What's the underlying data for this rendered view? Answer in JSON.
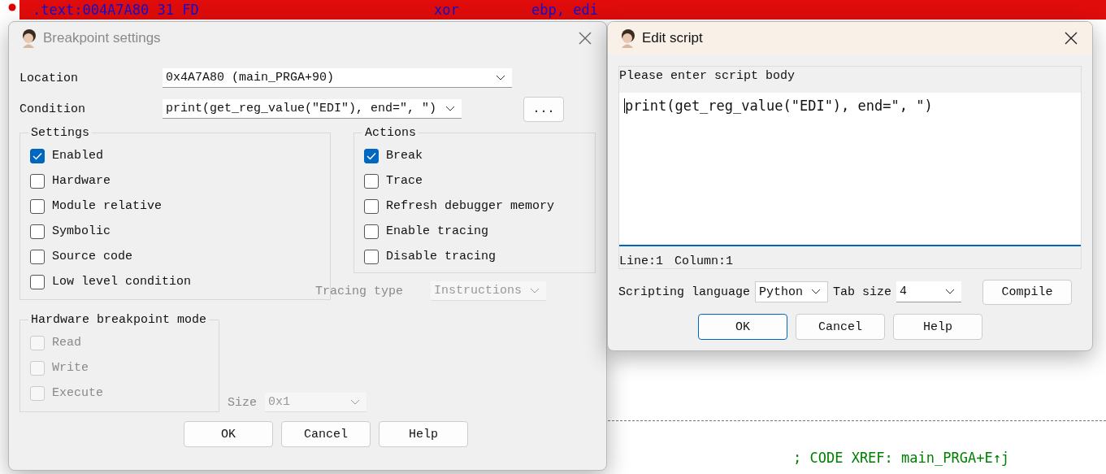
{
  "listing": {
    "highlighted_line": {
      "address": ".text:004A7A80 31 FD",
      "mnemonic": "xor",
      "operands": "ebp, edi"
    },
    "xref_comment": "; CODE XREF: main_PRGA+E↑j"
  },
  "breakpoint_dialog": {
    "title": "Breakpoint settings",
    "location": {
      "label": "Location",
      "value": "0x4A7A80 (main_PRGA+90)"
    },
    "condition": {
      "label": "Condition",
      "value": "print(get_reg_value(″EDI″), end=″, ″)"
    },
    "more_button": "...",
    "settings": {
      "title": "Settings",
      "items": [
        {
          "label": "Enabled",
          "checked": true,
          "disabled": false
        },
        {
          "label": "Hardware",
          "checked": false,
          "disabled": false
        },
        {
          "label": "Module relative",
          "checked": false,
          "disabled": false
        },
        {
          "label": "Symbolic",
          "checked": false,
          "disabled": false
        },
        {
          "label": "Source code",
          "checked": false,
          "disabled": false
        },
        {
          "label": "Low level condition",
          "checked": false,
          "disabled": false
        }
      ]
    },
    "actions": {
      "title": "Actions",
      "items": [
        {
          "label": "Break",
          "checked": true,
          "disabled": false
        },
        {
          "label": "Trace",
          "checked": false,
          "disabled": false
        },
        {
          "label": "Refresh debugger memory",
          "checked": false,
          "disabled": false
        },
        {
          "label": "Enable tracing",
          "checked": false,
          "disabled": false
        },
        {
          "label": "Disable tracing",
          "checked": false,
          "disabled": false
        }
      ]
    },
    "tracing_type": {
      "label": "Tracing type",
      "value": "Instructions",
      "disabled": true
    },
    "hardware_mode": {
      "title": "Hardware breakpoint mode",
      "items": [
        {
          "label": "Read",
          "checked": false,
          "disabled": true
        },
        {
          "label": "Write",
          "checked": false,
          "disabled": true
        },
        {
          "label": "Execute",
          "checked": false,
          "disabled": true
        }
      ]
    },
    "size": {
      "label": "Size",
      "value": "0x1",
      "disabled": true
    },
    "buttons": [
      {
        "label": "OK",
        "default": false
      },
      {
        "label": "Cancel",
        "default": false
      },
      {
        "label": "Help",
        "default": false
      }
    ]
  },
  "script_dialog": {
    "title": "Edit script",
    "prompt": "Please enter script body",
    "body": "print(get_reg_value(\"EDI\"), end=\", \")",
    "status": {
      "line": "Line:1",
      "column": "Column:1"
    },
    "language": {
      "label": "Scripting language",
      "value": "Python"
    },
    "tab_size": {
      "label": "Tab size",
      "value": "4"
    },
    "compile_button": "Compile",
    "buttons": [
      {
        "label": "OK",
        "default": true
      },
      {
        "label": "Cancel",
        "default": false
      },
      {
        "label": "Help",
        "default": false
      }
    ]
  }
}
